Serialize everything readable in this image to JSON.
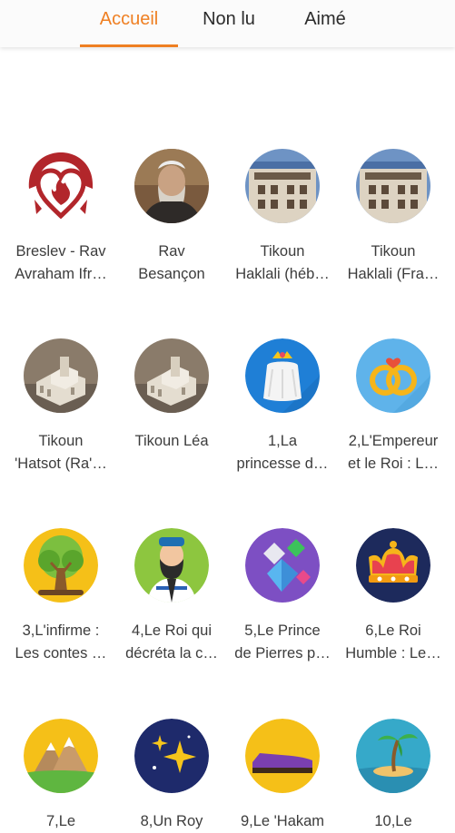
{
  "tabs": [
    {
      "label": "Accueil",
      "active": true
    },
    {
      "label": "Non lu",
      "active": false
    },
    {
      "label": "Aimé",
      "active": false
    }
  ],
  "accent_color": "#ef7f22",
  "items": [
    {
      "label": "Breslev - Rav\nAvraham Ifr…",
      "icon": "breslev-logo-icon"
    },
    {
      "label": "Rav\nBesançon",
      "icon": "rav-portrait-icon"
    },
    {
      "label": "Tikoun\nHaklali (héb…",
      "icon": "building-photo-icon"
    },
    {
      "label": "Tikoun\nHaklali (Fra…",
      "icon": "building-photo-icon"
    },
    {
      "label": "Tikoun\n'Hatsot (Ra'…",
      "icon": "temple-model-icon"
    },
    {
      "label": "Tikoun Léa",
      "icon": "temple-model-icon"
    },
    {
      "label": "1,La\nprincesse d…",
      "icon": "princess-veil-icon"
    },
    {
      "label": "2,L'Empereur\net le Roi : L…",
      "icon": "wedding-rings-icon"
    },
    {
      "label": "3,L'infirme :\nLes contes …",
      "icon": "tree-icon"
    },
    {
      "label": "4,Le Roi qui\ndécréta la c…",
      "icon": "rabbi-tallit-icon"
    },
    {
      "label": "5,Le Prince\nde Pierres p…",
      "icon": "gemstones-icon"
    },
    {
      "label": "6,Le Roi\nHumble : Le…",
      "icon": "crown-icon"
    },
    {
      "label": "7,Le",
      "icon": "mountains-icon"
    },
    {
      "label": "8,Un Roy",
      "icon": "stars-icon"
    },
    {
      "label": "9,Le 'Hakam",
      "icon": "shoe-icon"
    },
    {
      "label": "10,Le",
      "icon": "palm-island-icon"
    }
  ]
}
